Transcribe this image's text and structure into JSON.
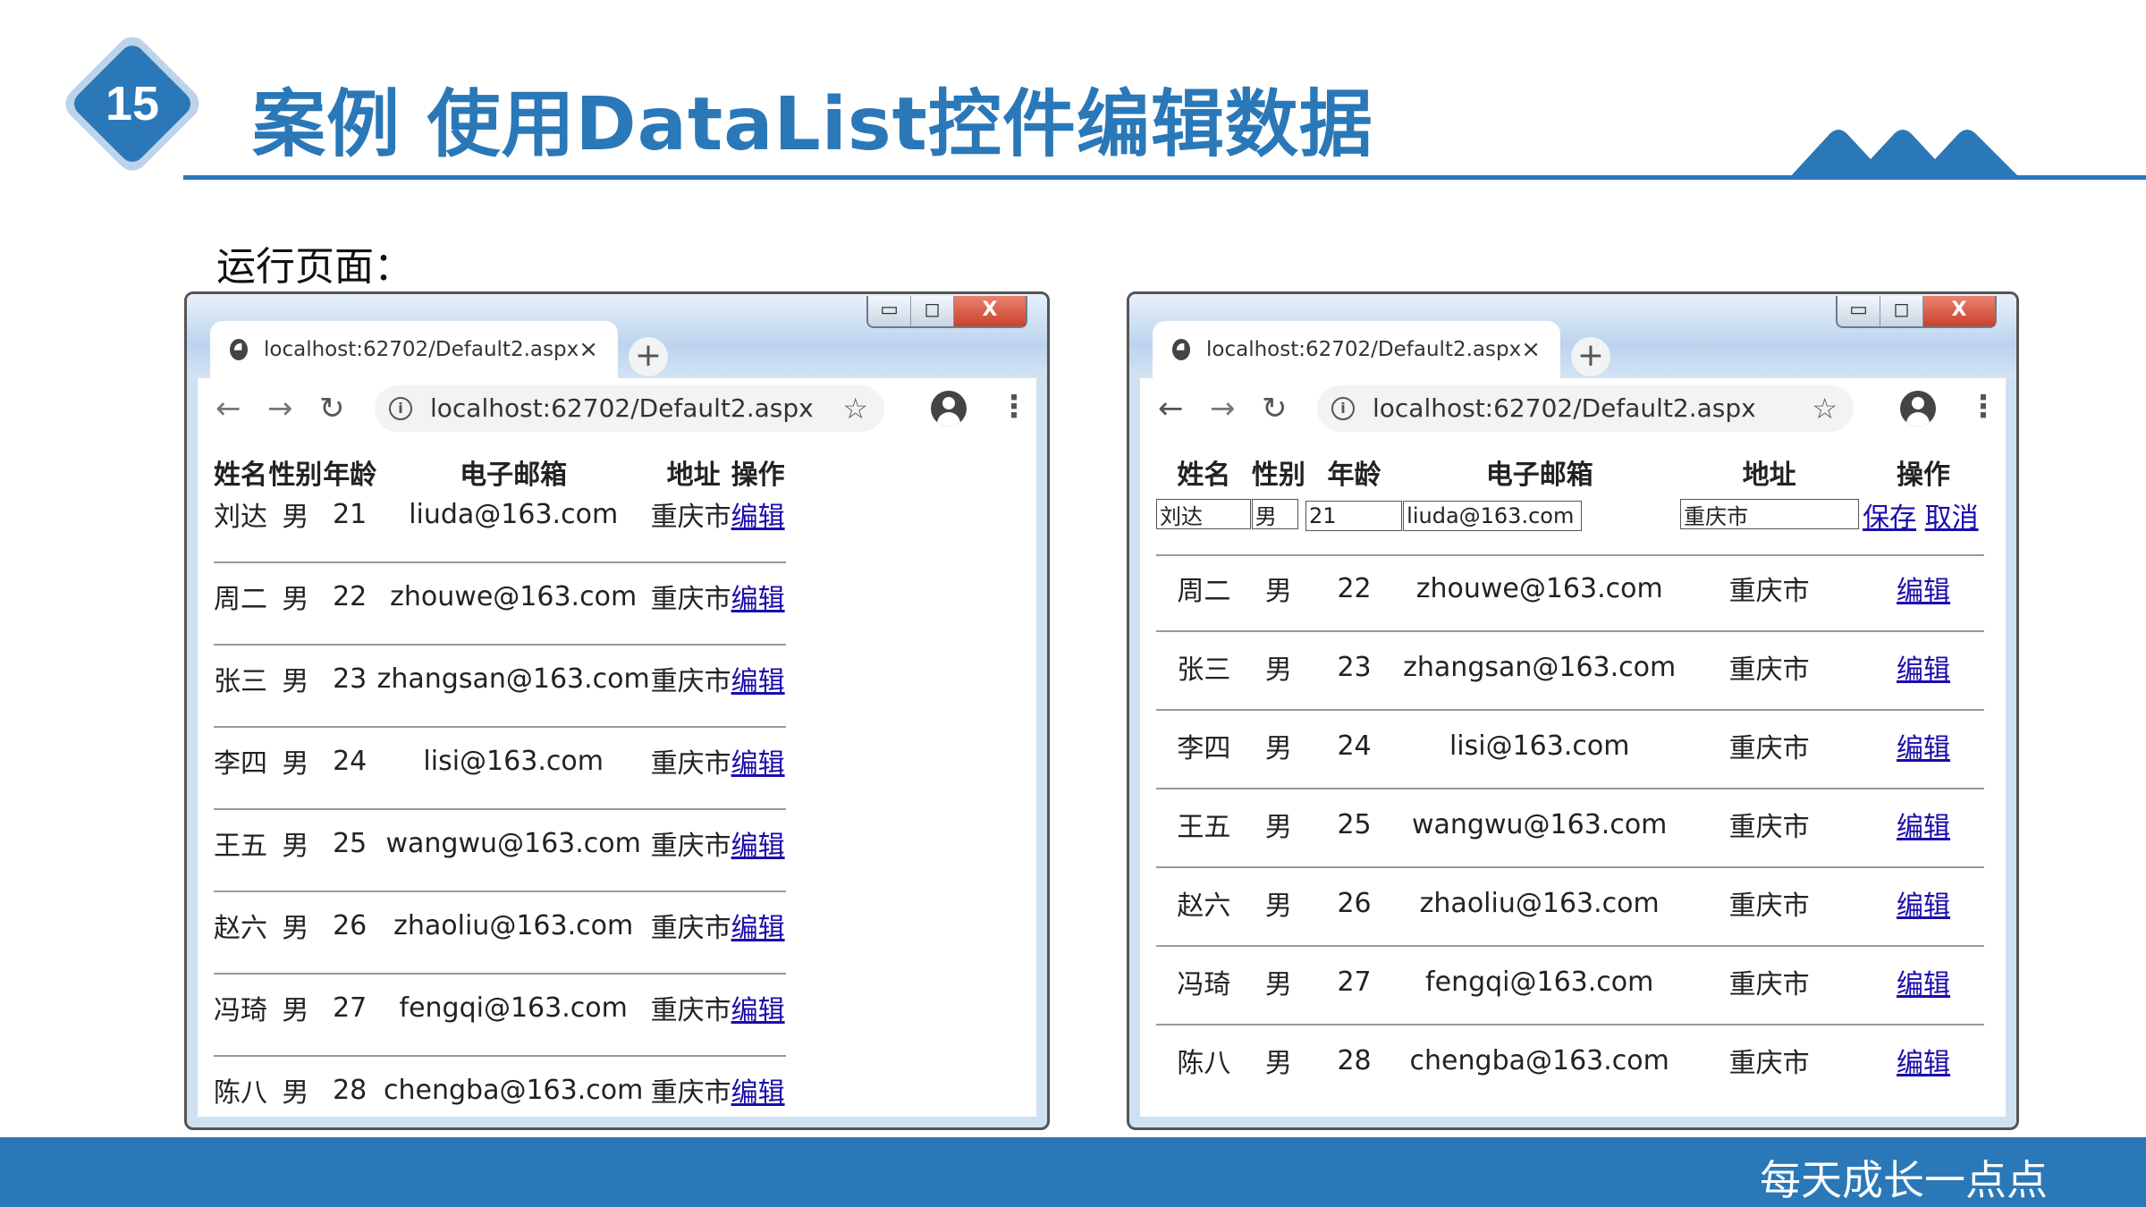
{
  "slide": {
    "number": "15",
    "title": "案例 使用DataList控件编辑数据",
    "subtitle": "运行页面：",
    "footer": "每天成长一点点"
  },
  "browser_tab": {
    "title": "localhost:62702/Default2.aspx",
    "close": "×",
    "new_tab": "+"
  },
  "address_bar": {
    "url": "localhost:62702/Default2.aspx"
  },
  "window_controls": {
    "minimize": "▭",
    "maximize": "◻",
    "close": "X"
  },
  "columns": [
    "姓名",
    "性别",
    "年龄",
    "电子邮箱",
    "地址",
    "操作"
  ],
  "rows": [
    {
      "name": "刘达",
      "gender": "男",
      "age": "21",
      "email": "liuda@163.com",
      "address": "重庆市",
      "action": "编辑"
    },
    {
      "name": "周二",
      "gender": "男",
      "age": "22",
      "email": "zhouwe@163.com",
      "address": "重庆市",
      "action": "编辑"
    },
    {
      "name": "张三",
      "gender": "男",
      "age": "23",
      "email": "zhangsan@163.com",
      "address": "重庆市",
      "action": "编辑"
    },
    {
      "name": "李四",
      "gender": "男",
      "age": "24",
      "email": "lisi@163.com",
      "address": "重庆市",
      "action": "编辑"
    },
    {
      "name": "王五",
      "gender": "男",
      "age": "25",
      "email": "wangwu@163.com",
      "address": "重庆市",
      "action": "编辑"
    },
    {
      "name": "赵六",
      "gender": "男",
      "age": "26",
      "email": "zhaoliu@163.com",
      "address": "重庆市",
      "action": "编辑"
    },
    {
      "name": "冯琦",
      "gender": "男",
      "age": "27",
      "email": "fengqi@163.com",
      "address": "重庆市",
      "action": "编辑"
    },
    {
      "name": "陈八",
      "gender": "男",
      "age": "28",
      "email": "chengba@163.com",
      "address": "重庆市",
      "action": "编辑"
    }
  ],
  "edit_row": {
    "name": "刘达",
    "gender": "男",
    "age": "21",
    "email": "liuda@163.com",
    "address": "重庆市",
    "save": "保存",
    "cancel": "取消"
  }
}
